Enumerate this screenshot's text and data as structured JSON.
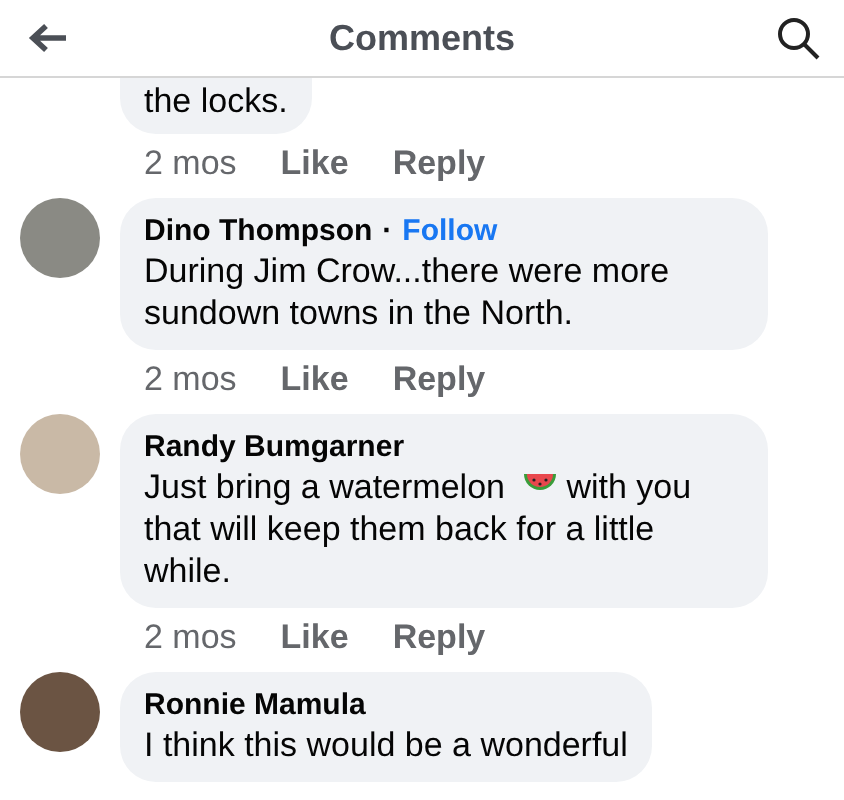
{
  "header": {
    "title": "Comments"
  },
  "comments": [
    {
      "body": [
        {
          "kind": "text",
          "text": "the locks."
        }
      ],
      "time": "2 mos",
      "like": "Like",
      "reply": "Reply"
    },
    {
      "name": "Dino Thompson",
      "separator": "·",
      "follow": "Follow",
      "body": [
        {
          "kind": "text",
          "text": "During Jim Crow...there were more sundown towns in the North."
        }
      ],
      "time": "2 mos",
      "like": "Like",
      "reply": "Reply"
    },
    {
      "name": "Randy Bumgarner",
      "body": [
        {
          "kind": "text",
          "text": "Just bring a watermelon"
        },
        {
          "kind": "watermelon"
        },
        {
          "kind": "text",
          "text": "with you that will keep them back for a little while."
        }
      ],
      "time": "2 mos",
      "like": "Like",
      "reply": "Reply"
    },
    {
      "name": "Ronnie Mamula",
      "body": [
        {
          "kind": "text",
          "text": "I think this would be a wonderful"
        }
      ]
    }
  ]
}
